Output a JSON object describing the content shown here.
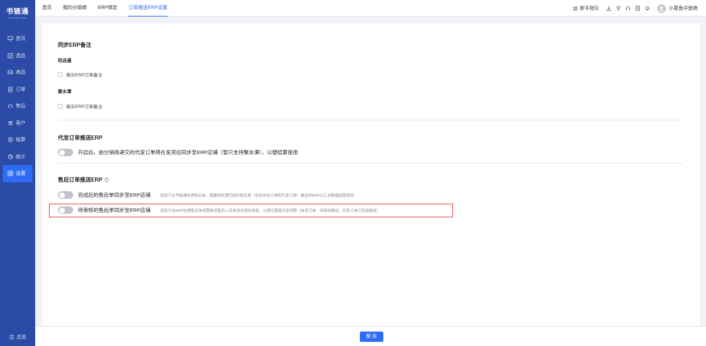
{
  "brand": {
    "name": "书链通",
    "sub": "SHULIAN TONG"
  },
  "sidebar": {
    "items": [
      {
        "label": "首页",
        "icon": "monitor-icon"
      },
      {
        "label": "选品",
        "icon": "select-icon"
      },
      {
        "label": "商品",
        "icon": "goods-icon"
      },
      {
        "label": "订单",
        "icon": "order-icon"
      },
      {
        "label": "售后",
        "icon": "headset-icon"
      },
      {
        "label": "客户",
        "icon": "customer-icon"
      },
      {
        "label": "结算",
        "icon": "settle-icon"
      },
      {
        "label": "统计",
        "icon": "chart-icon"
      },
      {
        "label": "设置",
        "icon": "settings-icon"
      }
    ],
    "active_index": 8,
    "bottom_label": "总览"
  },
  "header": {
    "tabs": [
      "首页",
      "我的分销商",
      "ERP绑定",
      "订单推送ERP设置"
    ],
    "active_tab": 3,
    "guide_label": "新手指引",
    "user_name": "小尾鱼中盘商"
  },
  "sync_erp": {
    "title": "同步ERP备注",
    "groups": [
      {
        "name": "旺店通",
        "checkbox_label": "展示ERP订单备注",
        "checked": false
      },
      {
        "name": "聚水潭",
        "checkbox_label": "展示ERP订单备注",
        "checked": false
      }
    ]
  },
  "dropship": {
    "title": "代发订单推送ERP",
    "switch_label": "开启后，由分销商递交的代发订单将在发货后同步至ERP店铺（暂只支持聚水潭），以便结算使用",
    "enabled": false
  },
  "aftersale": {
    "title": "售后订单推送ERP",
    "items": [
      {
        "label": "完成后的售后单同步至ERP店铺",
        "desc": "适用于在书链通处理售后单，需要将处理完成的售后单（包含自发订单和代发订单）推送到ERP以汇总数据结算使用",
        "enabled": false
      },
      {
        "label": "待审核的售后单同步至ERP店铺",
        "desc": "适用于在ERP处理售后单或需推送售后入库单到仓库的场景，以便完善售后全流程（自发订单：待审核推送，代发订单已完成推送）",
        "enabled": false
      }
    ]
  },
  "footer": {
    "save_label": "保 存"
  },
  "colors": {
    "sidebar": "#2c4ba6",
    "accent": "#2f6cf6",
    "highlight": "#e5484d"
  }
}
